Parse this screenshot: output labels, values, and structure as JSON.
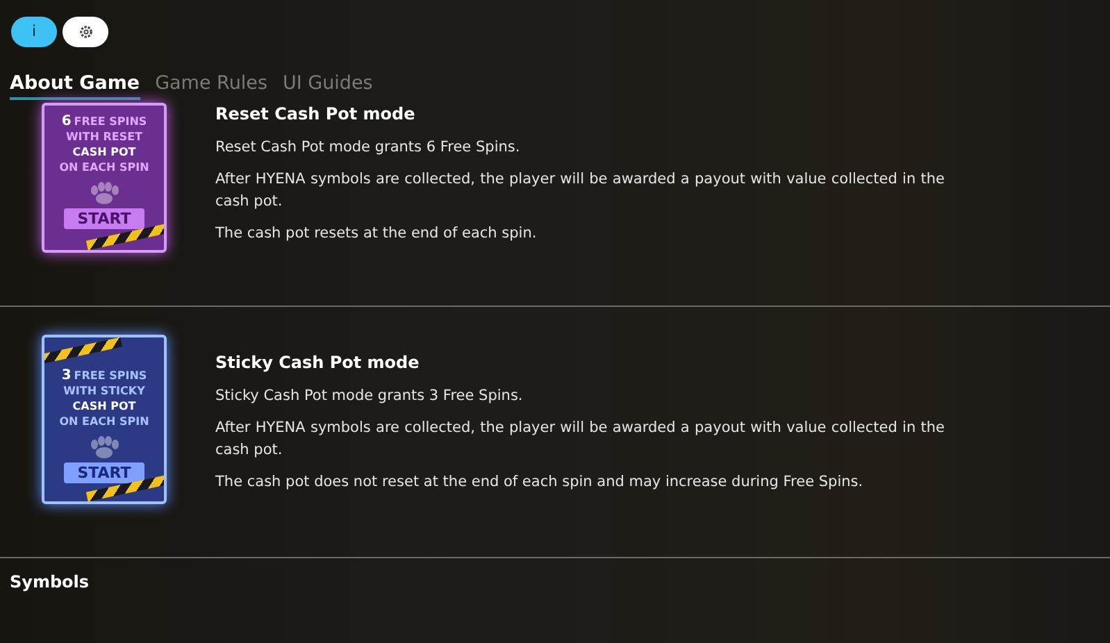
{
  "toolbar": [
    {
      "kind": "info",
      "label": "i",
      "selected": true
    },
    {
      "kind": "settings",
      "selected": false
    }
  ],
  "tabs": [
    {
      "label": "About Game",
      "selected": true
    },
    {
      "label": "Game Rules",
      "selected": false
    },
    {
      "label": "UI Guides",
      "selected": false
    }
  ],
  "sections": [
    {
      "kind": "reset",
      "card": {
        "count": "6",
        "lines": [
          "FREE SPINS",
          "WITH RESET",
          "CASH POT",
          "ON EACH SPIN"
        ],
        "button": "START"
      },
      "title": "Reset Cash Pot mode",
      "paragraphs": [
        "Reset Cash Pot mode grants 6 Free Spins.",
        "After HYENA symbols are collected, the player will be awarded a payout with value collected in the cash pot.",
        "The cash pot resets at the end of each spin."
      ]
    },
    {
      "kind": "sticky",
      "card": {
        "count": "3",
        "lines": [
          "FREE SPINS",
          "WITH STICKY",
          "CASH POT",
          "ON EACH SPIN"
        ],
        "button": "START"
      },
      "title": "Sticky Cash Pot mode",
      "paragraphs": [
        "Sticky Cash Pot mode grants 3 Free Spins.",
        "After HYENA symbols are collected, the player will be awarded a payout with value collected in the cash pot.",
        "The cash pot does not reset at the end of each spin and may increase during Free Spins."
      ]
    }
  ],
  "next_heading": "Symbols"
}
